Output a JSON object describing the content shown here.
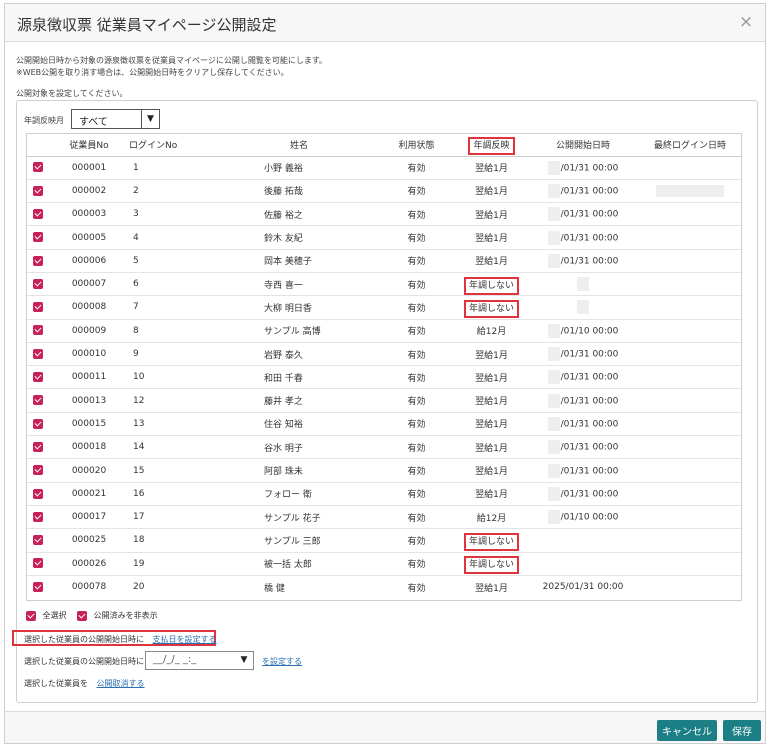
{
  "dialog": {
    "title": "源泉徴収票 従業員マイページ公開設定",
    "close_symbol": "×"
  },
  "notes": {
    "line1": "公開開始日時から対象の源泉徴収票を従業員マイページに公開し閲覧を可能にします。",
    "line2": "※WEB公開を取り消す場合は、公開開始日時をクリアし保存してください。",
    "line3": "公開対象を設定してください。"
  },
  "filter": {
    "label": "年調反映月",
    "value": "すべて"
  },
  "table": {
    "headers": [
      "",
      "従業員No",
      "ログインNo",
      "姓名",
      "利用状態",
      "年調反映",
      "公開開始日時",
      "最終ログイン日時"
    ],
    "rows": [
      {
        "emp": "000001",
        "login": "1",
        "name": "小野 義裕",
        "status": "有効",
        "reflect": "翌給1月",
        "start": "/01/31 00:00",
        "last": ""
      },
      {
        "emp": "000002",
        "login": "2",
        "name": "後藤 拓哉",
        "status": "有効",
        "reflect": "翌給1月",
        "start": "/01/31 00:00",
        "last": ""
      },
      {
        "emp": "000003",
        "login": "3",
        "name": "佐藤 裕之",
        "status": "有効",
        "reflect": "翌給1月",
        "start": "/01/31 00:00",
        "last": ""
      },
      {
        "emp": "000005",
        "login": "4",
        "name": "鈴木 友紀",
        "status": "有効",
        "reflect": "翌給1月",
        "start": "/01/31 00:00",
        "last": ""
      },
      {
        "emp": "000006",
        "login": "5",
        "name": "岡本 美穂子",
        "status": "有効",
        "reflect": "翌給1月",
        "start": "/01/31 00:00",
        "last": ""
      },
      {
        "emp": "000007",
        "login": "6",
        "name": "寺西 喜一",
        "status": "有効",
        "reflect": "年調しない",
        "start": "",
        "last": ""
      },
      {
        "emp": "000008",
        "login": "7",
        "name": "大柳 明日香",
        "status": "有効",
        "reflect": "年調しない",
        "start": "",
        "last": ""
      },
      {
        "emp": "000009",
        "login": "8",
        "name": "サンプル 高博",
        "status": "有効",
        "reflect": "給12月",
        "start": "/01/10 00:00",
        "last": ""
      },
      {
        "emp": "000010",
        "login": "9",
        "name": "岩野 泰久",
        "status": "有効",
        "reflect": "翌給1月",
        "start": "/01/31 00:00",
        "last": ""
      },
      {
        "emp": "000011",
        "login": "10",
        "name": "和田 千春",
        "status": "有効",
        "reflect": "翌給1月",
        "start": "/01/31 00:00",
        "last": ""
      },
      {
        "emp": "000013",
        "login": "12",
        "name": "藤井 孝之",
        "status": "有効",
        "reflect": "翌給1月",
        "start": "/01/31 00:00",
        "last": ""
      },
      {
        "emp": "000015",
        "login": "13",
        "name": "住谷 知裕",
        "status": "有効",
        "reflect": "翌給1月",
        "start": "/01/31 00:00",
        "last": ""
      },
      {
        "emp": "000018",
        "login": "14",
        "name": "谷水 明子",
        "status": "有効",
        "reflect": "翌給1月",
        "start": "/01/31 00:00",
        "last": ""
      },
      {
        "emp": "000020",
        "login": "15",
        "name": "阿部 珠未",
        "status": "有効",
        "reflect": "翌給1月",
        "start": "/01/31 00:00",
        "last": ""
      },
      {
        "emp": "000021",
        "login": "16",
        "name": "フォロー 衛",
        "status": "有効",
        "reflect": "翌給1月",
        "start": "/01/31 00:00",
        "last": ""
      },
      {
        "emp": "000017",
        "login": "17",
        "name": "サンプル 花子",
        "status": "有効",
        "reflect": "給12月",
        "start": "/01/10 00:00",
        "last": ""
      },
      {
        "emp": "000025",
        "login": "18",
        "name": "サンプル 三郎",
        "status": "有効",
        "reflect": "年調しない",
        "start": "",
        "last": ""
      },
      {
        "emp": "000026",
        "login": "19",
        "name": "被一括 太郎",
        "status": "有効",
        "reflect": "年調しない",
        "start": "",
        "last": ""
      },
      {
        "emp": "000078",
        "login": "20",
        "name": "橋 健",
        "status": "有効",
        "reflect": "翌給1月",
        "start": "2025/01/31 00:00",
        "last": ""
      }
    ]
  },
  "options": {
    "select_all": "全選択",
    "hide_published": "公開済みを非表示"
  },
  "actions": {
    "row1_label": "選択した従業員の公開開始日時に",
    "row1_link": "支払日を設定する",
    "row2_label": "選択した従業員の公開開始日時に",
    "row2_input": "__/_/_ _:_",
    "row2_link": "を設定する",
    "row3_label": "選択した従業員を",
    "row3_link": "公開取消する"
  },
  "buttons": {
    "cancel": "キャンセル",
    "save": "保存"
  },
  "colors": {
    "checkbox": "#c6215a",
    "highlight": "#e0333d",
    "primary_button": "#1c7f86",
    "link": "#2a6fb0"
  }
}
